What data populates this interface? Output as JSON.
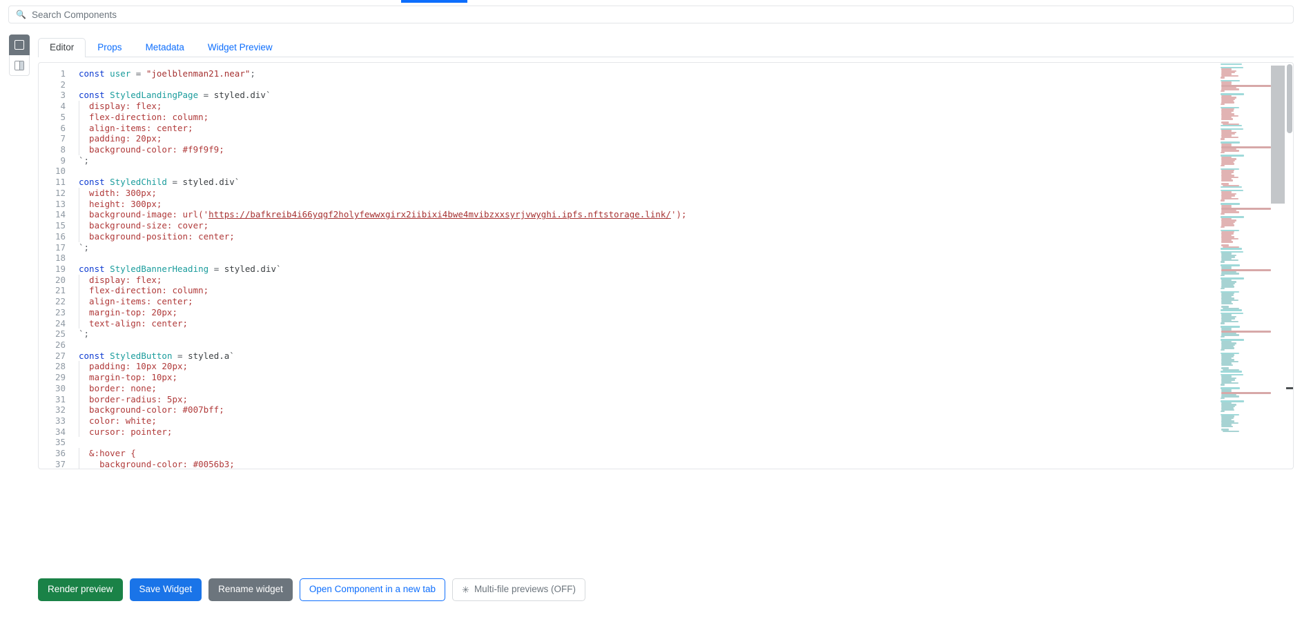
{
  "search": {
    "icon": "search-icon",
    "placeholder": "Search Components",
    "value": ""
  },
  "rail": {
    "items": [
      {
        "icon": "single-pane-layout-icon",
        "label": "Single pane",
        "active": true
      },
      {
        "icon": "split-pane-layout-icon",
        "label": "Split pane",
        "active": false
      }
    ]
  },
  "tabs": [
    {
      "label": "Editor",
      "active": true
    },
    {
      "label": "Props",
      "active": false
    },
    {
      "label": "Metadata",
      "active": false
    },
    {
      "label": "Widget Preview",
      "active": false
    }
  ],
  "editor": {
    "language": "javascript",
    "first_visible_line": 1,
    "last_visible_line": 37,
    "url_literal": "https://bafkreib4i66yqgf2holyfewwxgirx2iibixi4bwe4mvibzxxsyrjvwyghi.ipfs.nftstorage.link/",
    "lines": [
      {
        "n": 1,
        "text": "const user = \"joelblenman21.near\";"
      },
      {
        "n": 2,
        "text": ""
      },
      {
        "n": 3,
        "text": "const StyledLandingPage = styled.div`"
      },
      {
        "n": 4,
        "text": "  display: flex;"
      },
      {
        "n": 5,
        "text": "  flex-direction: column;"
      },
      {
        "n": 6,
        "text": "  align-items: center;"
      },
      {
        "n": 7,
        "text": "  padding: 20px;"
      },
      {
        "n": 8,
        "text": "  background-color: #f9f9f9;"
      },
      {
        "n": 9,
        "text": "`;"
      },
      {
        "n": 10,
        "text": ""
      },
      {
        "n": 11,
        "text": "const StyledChild = styled.div`"
      },
      {
        "n": 12,
        "text": "  width: 300px;"
      },
      {
        "n": 13,
        "text": "  height: 300px;"
      },
      {
        "n": 14,
        "text": "  background-image: url('https://bafkreib4i66yqgf2holyfewwxgirx2iibixi4bwe4mvibzxxsyrjvwyghi.ipfs.nftstorage.link/');"
      },
      {
        "n": 15,
        "text": "  background-size: cover;"
      },
      {
        "n": 16,
        "text": "  background-position: center;"
      },
      {
        "n": 17,
        "text": "`;"
      },
      {
        "n": 18,
        "text": ""
      },
      {
        "n": 19,
        "text": "const StyledBannerHeading = styled.div`"
      },
      {
        "n": 20,
        "text": "  display: flex;"
      },
      {
        "n": 21,
        "text": "  flex-direction: column;"
      },
      {
        "n": 22,
        "text": "  align-items: center;"
      },
      {
        "n": 23,
        "text": "  margin-top: 20px;"
      },
      {
        "n": 24,
        "text": "  text-align: center;"
      },
      {
        "n": 25,
        "text": "`;"
      },
      {
        "n": 26,
        "text": ""
      },
      {
        "n": 27,
        "text": "const StyledButton = styled.a`"
      },
      {
        "n": 28,
        "text": "  padding: 10px 20px;"
      },
      {
        "n": 29,
        "text": "  margin-top: 10px;"
      },
      {
        "n": 30,
        "text": "  border: none;"
      },
      {
        "n": 31,
        "text": "  border-radius: 5px;"
      },
      {
        "n": 32,
        "text": "  background-color: #007bff;"
      },
      {
        "n": 33,
        "text": "  color: white;"
      },
      {
        "n": 34,
        "text": "  cursor: pointer;"
      },
      {
        "n": 35,
        "text": ""
      },
      {
        "n": 36,
        "text": "  &:hover {"
      },
      {
        "n": 37,
        "text": "    background-color: #0056b3;"
      }
    ]
  },
  "toolbar": {
    "render_preview": "Render preview",
    "save_widget": "Save Widget",
    "rename_widget": "Rename widget",
    "open_component": "Open Component in a new tab",
    "multifile_icon": "✳",
    "multifile_previews": "Multi-file previews (OFF)"
  },
  "colors": {
    "green": "#1a8247",
    "blue": "#1a74e8",
    "grey": "#6c757d",
    "link": "#0d6efd",
    "keyword": "#0d3bd1",
    "class": "#1a9c9c",
    "string": "#a63232",
    "property": "#b03a3a"
  }
}
